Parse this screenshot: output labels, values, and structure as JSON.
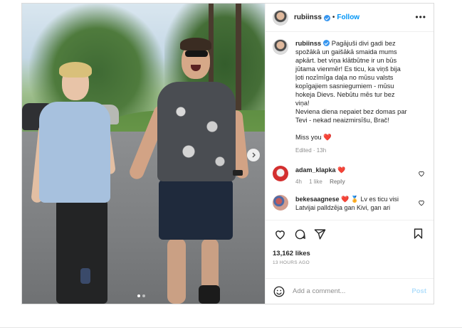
{
  "post": {
    "author": "rubiinss",
    "follow_label": "Follow",
    "separator": "•",
    "more_label": "•••",
    "caption": {
      "author": "rubiinss",
      "lines": [
        "Pagājuši divi gadi bez",
        "spožākā un gaišākā smaida mums",
        "apkārt. bet viņa klātbūtne ir un būs",
        "jūtama vienmēr! Es ticu, ka viņš bija",
        "ļoti nozīmīga daļa no mūsu valsts",
        "kopīgajiem sasniegumiem - mūsu",
        "hokeja Dievs. Nebūtu mēs tur bez",
        "viņa!",
        "Neviena diena nepaiet bez domas par",
        "Tevi - nekad neaizmirsīšu, Brač!"
      ],
      "closing": "Miss you",
      "heart": "❤️",
      "edited": "Edited · 13h"
    },
    "comments": [
      {
        "user": "adam_klapka",
        "text": "❤️",
        "time": "4h",
        "likes": "1 like",
        "reply": "Reply"
      },
      {
        "user": "bekesaagnese",
        "text": "❤️ 🏅 Lv es ticu visi",
        "text2": "Latvijai palldzēja gan Kivi, gan ari"
      }
    ],
    "likes": "13,162 likes",
    "ago": "13 HOURS AGO",
    "add_comment_placeholder": "Add a comment...",
    "post_label": "Post"
  },
  "colors": {
    "accent": "#0095f6",
    "heart": "#ed4956",
    "verified": "#3897f0"
  },
  "icons": {
    "verified": "verified-badge-icon",
    "more": "more-options-icon",
    "like": "heart-icon",
    "comment": "comment-icon",
    "share": "share-icon",
    "save": "bookmark-icon",
    "emoji": "emoji-icon",
    "next": "chevron-right-icon"
  }
}
